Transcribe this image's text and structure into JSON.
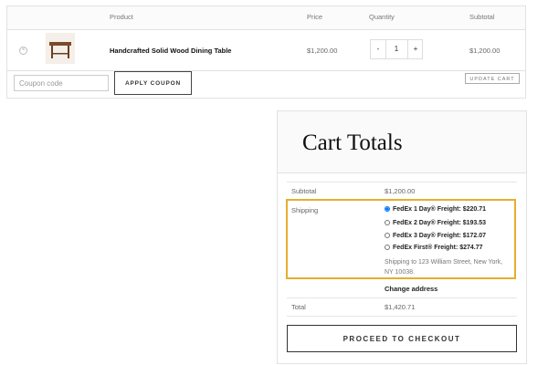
{
  "cart": {
    "headers": {
      "product": "Product",
      "price": "Price",
      "quantity": "Quantity",
      "subtotal": "Subtotal"
    },
    "item": {
      "name": "Handcrafted Solid Wood Dining Table",
      "price": "$1,200.00",
      "quantity": "1",
      "subtotal": "$1,200.00",
      "remove_icon": "×",
      "minus": "-",
      "plus": "+"
    },
    "coupon": {
      "placeholder": "Coupon code",
      "apply_label": "APPLY COUPON"
    },
    "update_label": "UPDATE CART"
  },
  "totals": {
    "title": "Cart Totals",
    "subtotal_label": "Subtotal",
    "subtotal_value": "$1,200.00",
    "shipping_label": "Shipping",
    "shipping_options": [
      {
        "label": "FedEx 1 Day® Freight: $220.71",
        "selected": true
      },
      {
        "label": "FedEx 2 Day® Freight: $193.53",
        "selected": false
      },
      {
        "label": "FedEx 3 Day® Freight: $172.07",
        "selected": false
      },
      {
        "label": "FedEx First® Freight: $274.77",
        "selected": false
      }
    ],
    "shipping_note": "Shipping to 123 William Street, New York, NY 10038.",
    "change_address": "Change address",
    "total_label": "Total",
    "total_value": "$1,420.71",
    "checkout_label": "PROCEED TO CHECKOUT"
  }
}
